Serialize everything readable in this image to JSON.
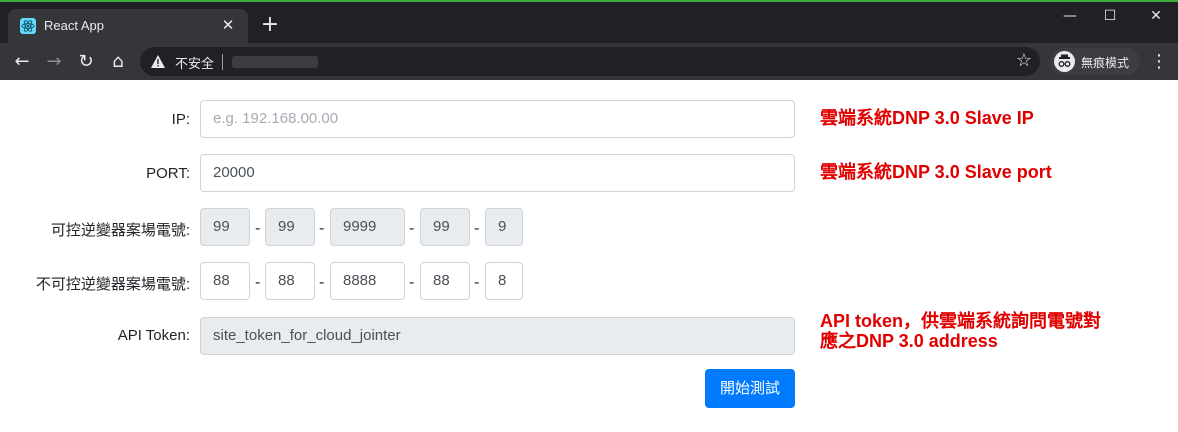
{
  "browser": {
    "tab_title": "React App",
    "tab_close": "✕",
    "new_tab": "+",
    "window_controls": {
      "minimize": "—",
      "maximize": "☐",
      "close": "✕"
    },
    "nav": {
      "back": "←",
      "forward": "→",
      "reload": "↻",
      "home": "⌂"
    },
    "security_label": "不安全",
    "incognito_label": "無痕模式",
    "menu": "⋮",
    "star": "☆"
  },
  "form": {
    "ip": {
      "label": "IP:",
      "placeholder": "e.g. 192.168.00.00",
      "value": ""
    },
    "port": {
      "label": "PORT:",
      "value": "20000"
    },
    "controllable_phone": {
      "label": "可控逆變器案場電號:",
      "parts": [
        "99",
        "99",
        "9999",
        "99",
        "9"
      ]
    },
    "uncontrollable_phone": {
      "label": "不可控逆變器案場電號:",
      "parts": [
        "88",
        "88",
        "8888",
        "88",
        "8"
      ]
    },
    "api_token": {
      "label": "API Token:",
      "value": "site_token_for_cloud_jointer"
    },
    "separator": "-",
    "start_button": "開始測試"
  },
  "annotations": {
    "ip_note": "雲端系統DNP 3.0 Slave IP",
    "port_note": "雲端系統DNP 3.0 Slave port",
    "token_note_line1": "API token，供雲端系統詢問電號對",
    "token_note_line2": "應之DNP 3.0 address"
  },
  "colors": {
    "primary": "#007bff",
    "annotation": "#e00000",
    "chrome": "#202124"
  }
}
